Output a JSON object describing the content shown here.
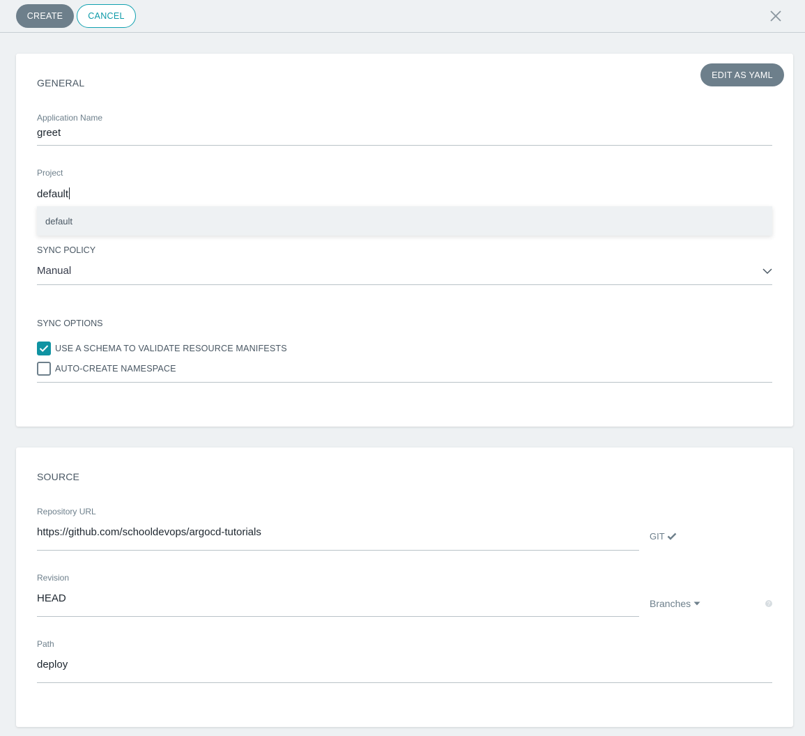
{
  "toolbar": {
    "create_label": "CREATE",
    "cancel_label": "CANCEL"
  },
  "general": {
    "title": "GENERAL",
    "edit_yaml_label": "EDIT AS YAML",
    "app_name_label": "Application Name",
    "app_name_value": "greet",
    "project_label": "Project",
    "project_value": "default",
    "project_options": [
      "default"
    ],
    "sync_policy_label": "SYNC POLICY",
    "sync_policy_value": "Manual",
    "sync_options_label": "SYNC OPTIONS",
    "options": [
      {
        "label": "USE A SCHEMA TO VALIDATE RESOURCE MANIFESTS",
        "checked": true
      },
      {
        "label": "AUTO-CREATE NAMESPACE",
        "checked": false
      }
    ]
  },
  "source": {
    "title": "SOURCE",
    "repo_url_label": "Repository URL",
    "repo_url_value": "https://github.com/schooldevops/argocd-tutorials",
    "repo_type": "GIT",
    "revision_label": "Revision",
    "revision_value": "HEAD",
    "revision_type": "Branches",
    "path_label": "Path",
    "path_value": "deploy"
  },
  "colors": {
    "accent": "#0f93a2",
    "button_gray": "#6d7f8b",
    "background": "#eef1f3"
  },
  "icons": {
    "close": "close-icon",
    "chevron": "chevron-down-icon",
    "check": "check-icon",
    "caret": "caret-down-icon",
    "help": "help-icon"
  }
}
